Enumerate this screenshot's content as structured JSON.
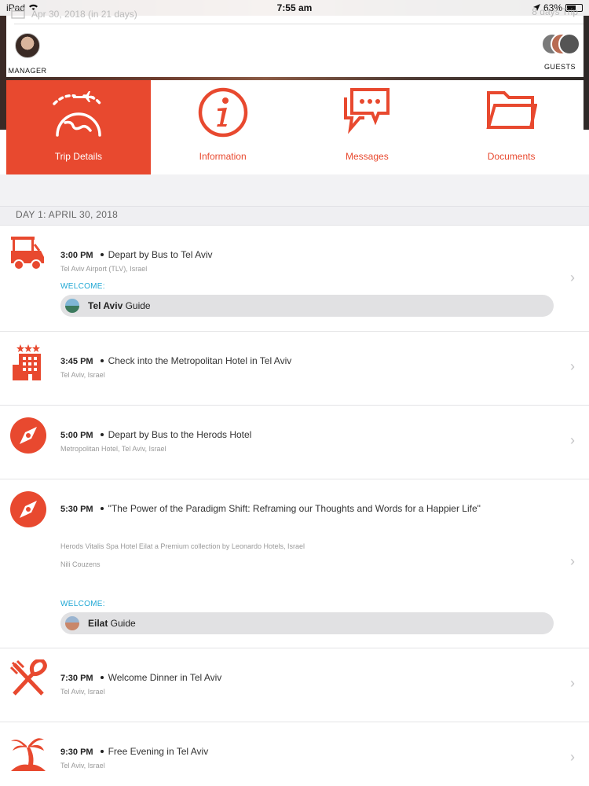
{
  "status_bar": {
    "carrier": "iPad",
    "time": "7:55 am",
    "battery": "63%",
    "battery_level": 0.63
  },
  "trip": {
    "date": "Apr 30, 2018 (in 21 days)",
    "length": "8 days Trip"
  },
  "people": {
    "manager_label": "MANAGER",
    "guests_label": "GUESTS"
  },
  "tabs": [
    {
      "label": "Trip Details",
      "icon": "plane-globe-icon",
      "active": true
    },
    {
      "label": "Information",
      "icon": "info-icon",
      "active": false
    },
    {
      "label": "Messages",
      "icon": "chat-bubbles-icon",
      "active": false
    },
    {
      "label": "Documents",
      "icon": "folder-icon",
      "active": false
    }
  ],
  "colors": {
    "accent": "#e8492f",
    "welcome": "#1fa7d4"
  },
  "day": {
    "header": "DAY 1: APRIL 30, 2018"
  },
  "items": [
    {
      "time": "3:00 PM",
      "title": "Depart by Bus to Tel Aviv",
      "sub": "Tel Aviv Airport (TLV), Israel",
      "welcome": "WELCOME:",
      "guide_bold": "Tel Aviv",
      "guide_rest": " Guide",
      "icon": "golf-cart-icon"
    },
    {
      "time": "3:45 PM",
      "title": "Check into the Metropolitan Hotel in Tel Aviv",
      "sub": "Tel Aviv, Israel",
      "icon": "hotel-icon"
    },
    {
      "time": "5:00 PM",
      "title": "Depart by Bus to the Herods Hotel",
      "sub": "Metropolitan Hotel, Tel Aviv, Israel",
      "icon": "compass-icon"
    },
    {
      "time": "5:30 PM",
      "title": "\"The Power of the Paradigm Shift: Reframing our Thoughts and Words for a Happier Life\"",
      "sub": "Herods Vitalis Spa Hotel Eilat a Premium collection by Leonardo Hotels, Israel",
      "sub2": "Nili Couzens",
      "welcome": "WELCOME:",
      "guide_bold": "Eilat",
      "guide_rest": " Guide",
      "icon": "compass-icon"
    },
    {
      "time": "7:30 PM",
      "title": "Welcome Dinner in Tel Aviv",
      "sub": "Tel Aviv, Israel",
      "icon": "fork-knife-icon"
    },
    {
      "time": "9:30 PM",
      "title": "Free Evening in Tel Aviv",
      "sub": "Tel Aviv, Israel",
      "icon": "palm-tree-icon"
    }
  ]
}
